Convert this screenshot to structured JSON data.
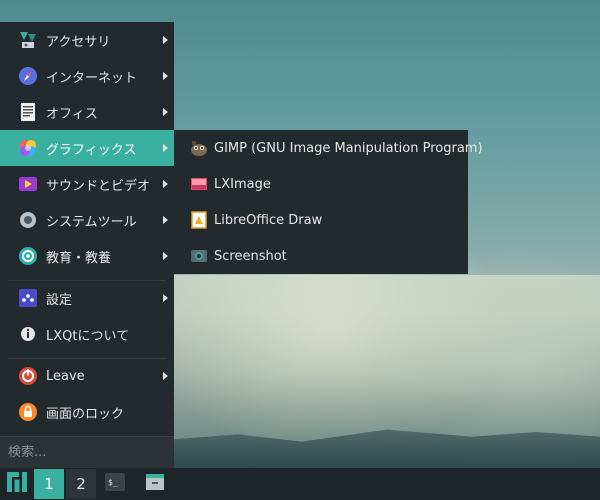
{
  "menu": {
    "items": [
      {
        "label": "アクセサリ",
        "icon": "accessories-icon",
        "submenu": true
      },
      {
        "label": "インターネット",
        "icon": "internet-icon",
        "submenu": true
      },
      {
        "label": "オフィス",
        "icon": "office-icon",
        "submenu": true
      },
      {
        "label": "グラフィックス",
        "icon": "graphics-icon",
        "submenu": true,
        "active": true
      },
      {
        "label": "サウンドとビデオ",
        "icon": "sound-video-icon",
        "submenu": true
      },
      {
        "label": "システムツール",
        "icon": "system-tools-icon",
        "submenu": true
      },
      {
        "label": "教育・教養",
        "icon": "education-icon",
        "submenu": true
      },
      {
        "label": "設定",
        "icon": "settings-icon",
        "submenu": true
      },
      {
        "label": "LXQtについて",
        "icon": "info-icon",
        "submenu": false
      },
      {
        "label": "Leave",
        "icon": "power-icon",
        "submenu": true
      },
      {
        "label": "画面のロック",
        "icon": "lock-icon",
        "submenu": false
      }
    ],
    "search_placeholder": "検索..."
  },
  "graphics_submenu": {
    "items": [
      {
        "label": "GIMP (GNU Image Manipulation Program)",
        "icon": "gimp-icon"
      },
      {
        "label": "LXImage",
        "icon": "image-viewer-icon"
      },
      {
        "label": "LibreOffice Draw",
        "icon": "libreoffice-draw-icon"
      },
      {
        "label": "Screenshot",
        "icon": "camera-icon"
      }
    ]
  },
  "taskbar": {
    "desktops": [
      "1",
      "2"
    ],
    "active_desktop": "1"
  },
  "colors": {
    "accent": "#3ab0a0",
    "menu_bg": "#232a2e",
    "taskbar_bg": "#1e2528"
  }
}
